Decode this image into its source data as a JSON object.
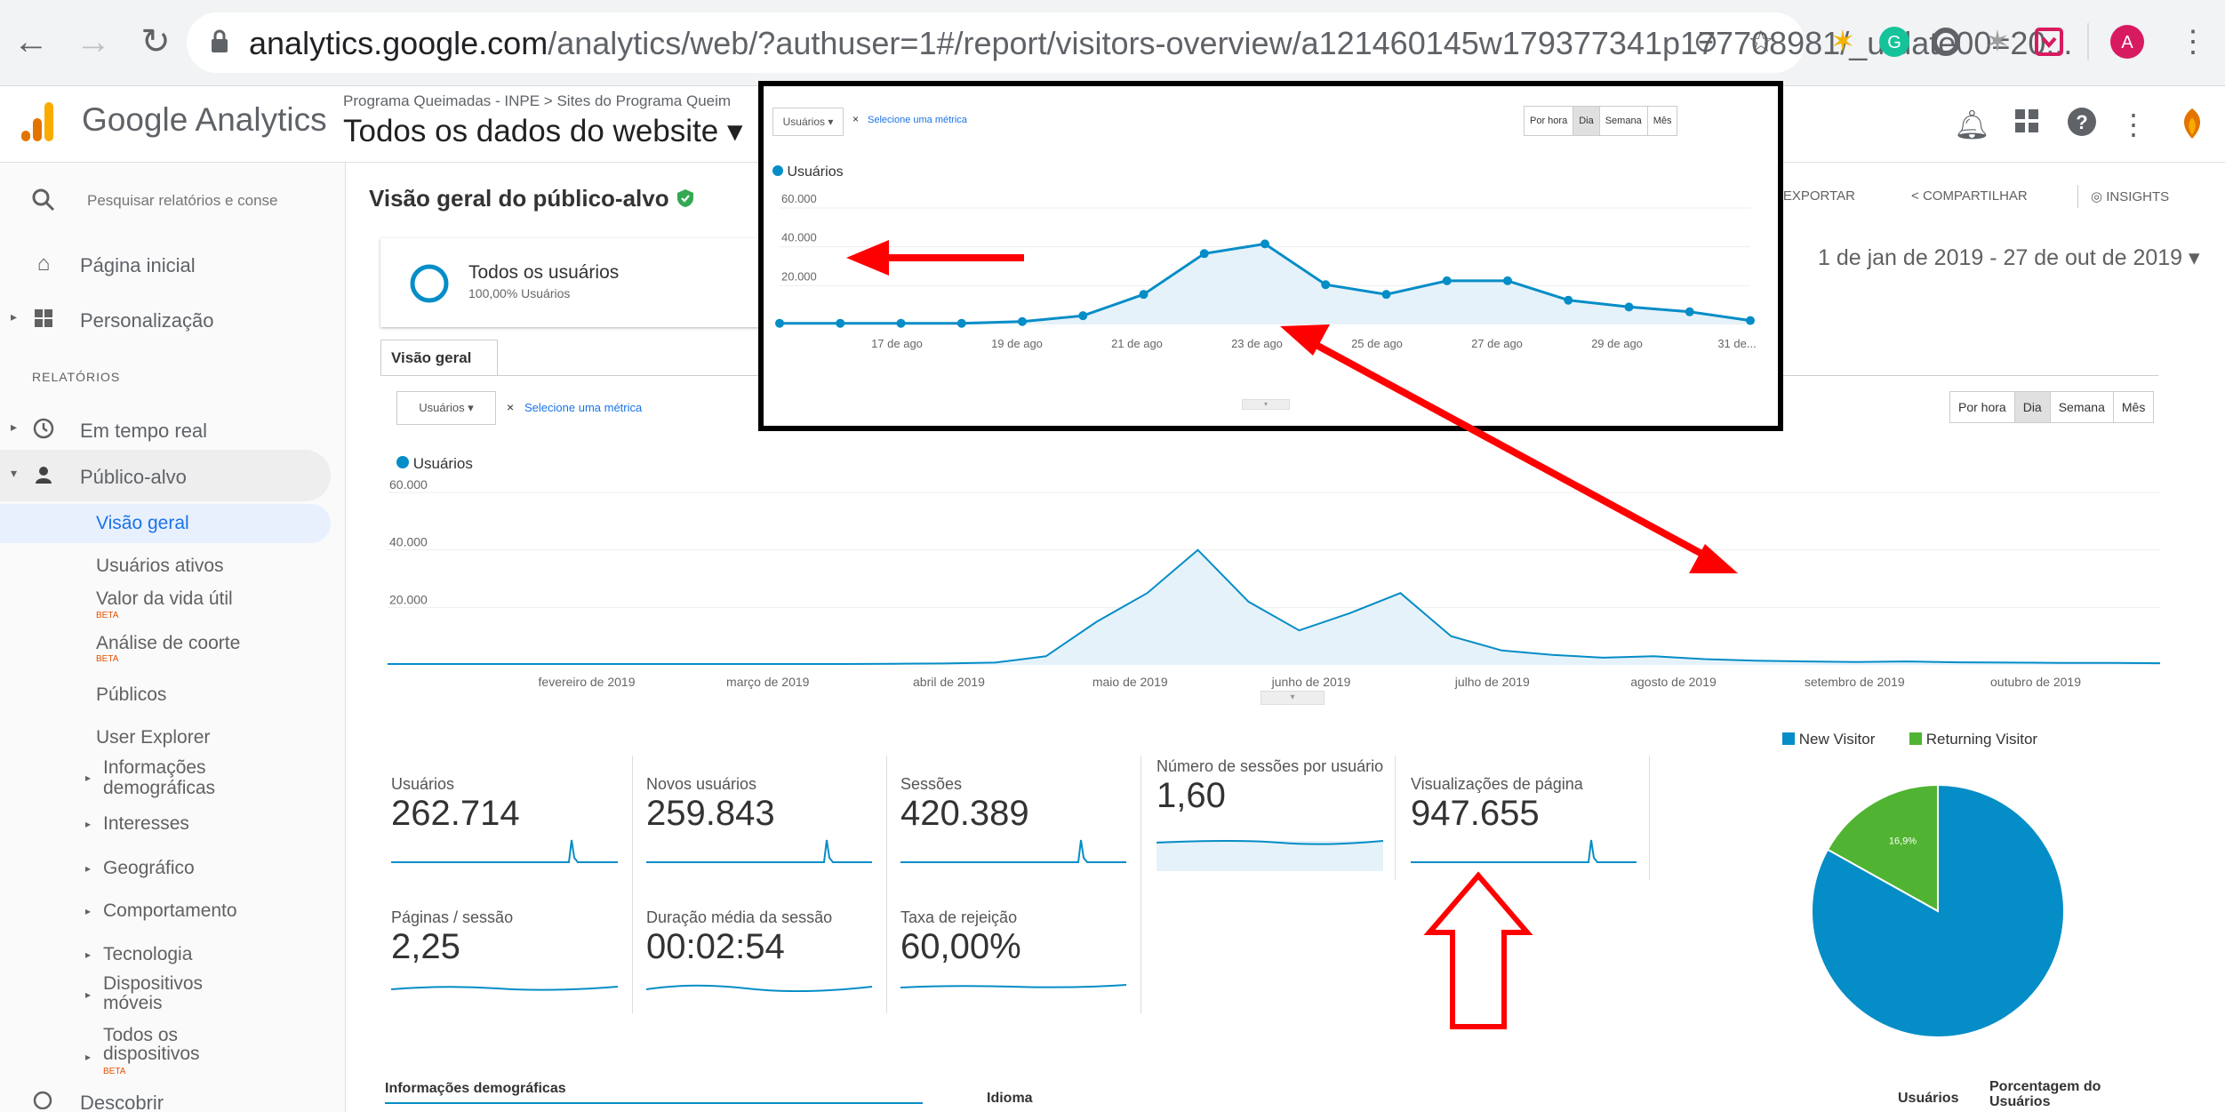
{
  "browser": {
    "url_domain": "analytics.google.com",
    "url_path": "/analytics/web/?authuser=1#/report/visitors-overview/a121460145w179377341p177708981/_u.date00=20...",
    "profile_letter": "A"
  },
  "header": {
    "brand": "Google Analytics",
    "breadcrumb": "Programa Queimadas - INPE > Sites do Programa Queim",
    "view_title": "Todos os dados do website ▾"
  },
  "sidebar": {
    "search_placeholder": "Pesquisar relatórios e conse",
    "items": [
      {
        "label": "Página inicial",
        "icon": "home-icon"
      },
      {
        "label": "Personalização",
        "icon": "grid-icon"
      }
    ],
    "section_label": "RELATÓRIOS",
    "reports": [
      {
        "label": "Em tempo real",
        "icon": "clock-icon"
      },
      {
        "label": "Público-alvo",
        "icon": "person-icon"
      }
    ],
    "audience_sub": [
      {
        "label": "Visão geral"
      },
      {
        "label": "Usuários ativos"
      },
      {
        "label": "Valor da vida útil",
        "beta": "BETA"
      },
      {
        "label": "Análise de coorte",
        "beta": "BETA"
      },
      {
        "label": "Públicos"
      },
      {
        "label": "User Explorer"
      },
      {
        "label": "Informações demográficas"
      },
      {
        "label": "Interesses"
      },
      {
        "label": "Geográfico"
      },
      {
        "label": "Comportamento"
      },
      {
        "label": "Tecnologia"
      },
      {
        "label": "Dispositivos móveis"
      },
      {
        "label": "Todos os dispositivos",
        "beta": "BETA"
      }
    ],
    "discover": "Descobrir"
  },
  "main": {
    "title": "Visão geral do público-alvo",
    "export": "EXPORTAR",
    "share": "COMPARTILHAR",
    "insights": "INSIGHTS",
    "date_range": "1 de jan de 2019 - 27 de out de 2019 ▾",
    "segment_name": "Todos os usuários",
    "segment_sub": "100,00% Usuários",
    "tab": "Visão geral",
    "metric_select": "Usuários",
    "select_metric_link": "Selecione uma métrica",
    "periods": [
      "Por hora",
      "Dia",
      "Semana",
      "Mês"
    ],
    "active_period": "Dia",
    "legend": "Usuários",
    "metrics": [
      {
        "label": "Usuários",
        "value": "262.714"
      },
      {
        "label": "Novos usuários",
        "value": "259.843"
      },
      {
        "label": "Sessões",
        "value": "420.389"
      },
      {
        "label": "Número de sessões por usuário",
        "value": "1,60"
      },
      {
        "label": "Visualizações de página",
        "value": "947.655"
      },
      {
        "label": "Páginas / sessão",
        "value": "2,25"
      },
      {
        "label": "Duração média da sessão",
        "value": "00:02:54"
      },
      {
        "label": "Taxa de rejeição",
        "value": "60,00%"
      }
    ],
    "pie_legend": [
      "New Visitor",
      "Returning Visitor"
    ],
    "demographics": "Informações demográficas",
    "language": "Idioma",
    "col_users": "Usuários",
    "col_pct": "Porcentagem do Usuários"
  },
  "colors": {
    "accent": "#058dc7",
    "returning": "#50b432",
    "annotation": "#ff0000"
  },
  "chart_data": [
    {
      "type": "area",
      "name": "main-users-chart",
      "x": [
        "fevereiro de 2019",
        "março de 2019",
        "abril de 2019",
        "maio de 2019",
        "junho de 2019",
        "julho de 2019",
        "agosto de 2019",
        "setembro de 2019",
        "outubro de 2019"
      ],
      "yticks": [
        "60.000",
        "40.000",
        "20.000"
      ],
      "ylim": [
        0,
        60000
      ],
      "series": [
        {
          "name": "Usuários",
          "values": [
            300,
            300,
            300,
            300,
            300,
            300,
            300,
            300,
            300,
            300,
            400,
            500,
            800,
            3000,
            15000,
            25000,
            40000,
            22000,
            12000,
            18000,
            25000,
            10000,
            5000,
            3500,
            2500,
            3000,
            2000,
            1500,
            1200,
            1000,
            1200,
            900,
            800,
            700,
            700,
            600
          ]
        }
      ]
    },
    {
      "type": "line",
      "name": "zoom-users-chart",
      "x": [
        "17 de ago",
        "19 de ago",
        "21 de ago",
        "23 de ago",
        "25 de ago",
        "27 de ago",
        "29 de ago",
        "31 de..."
      ],
      "yticks": [
        "60.000",
        "40.000",
        "20.000"
      ],
      "ylim": [
        0,
        60000
      ],
      "series": [
        {
          "name": "Usuários",
          "values": [
            600,
            600,
            600,
            600,
            1500,
            4500,
            15500,
            36500,
            41500,
            20500,
            15500,
            22500,
            22500,
            12500,
            9000,
            6500,
            2000
          ]
        }
      ]
    },
    {
      "type": "pie",
      "name": "visitor-pie",
      "labels": [
        "New Visitor",
        "Returning Visitor"
      ],
      "values": [
        83.1,
        16.9
      ],
      "data_labels": [
        "83,1%",
        "16,9%"
      ]
    }
  ]
}
